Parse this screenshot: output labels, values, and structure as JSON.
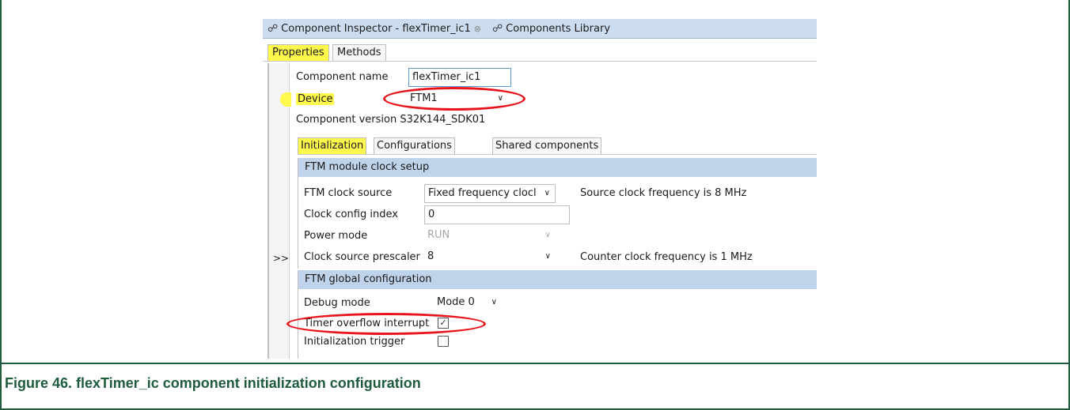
{
  "caption": "Figure 46.  flexTimer_ic component initialization configuration",
  "view_tabs": {
    "inspector": "Component Inspector - flexTimer_ic1",
    "library": "Components Library"
  },
  "prop_tabs": {
    "properties": "Properties",
    "methods": "Methods"
  },
  "component": {
    "name_label": "Component name",
    "name_value": "flexTimer_ic1",
    "device_label": "Device",
    "device_value": "FTM1",
    "version_text": "Component version  S32K144_SDK01"
  },
  "init_tabs": {
    "initialization": "Initialization",
    "configurations": "Configurations",
    "shared": "Shared components"
  },
  "gutter": {
    "expand": ">>"
  },
  "clock_group": {
    "title": "FTM module clock setup",
    "clock_source_label": "FTM clock source",
    "clock_source_value": "Fixed frequency clocl",
    "clock_source_info": "Source clock frequency is 8 MHz",
    "config_index_label": "Clock config index",
    "config_index_value": "0",
    "power_mode_label": "Power mode",
    "power_mode_value": "RUN",
    "prescaler_label": "Clock source prescaler",
    "prescaler_value": "8",
    "prescaler_info": "Counter clock frequency is 1 MHz"
  },
  "global_group": {
    "title": "FTM global configuration",
    "debug_label": "Debug mode",
    "debug_value": "Mode 0",
    "overflow_label": "Timer overflow interrupt",
    "overflow_checked": true,
    "trigger_label": "Initialization trigger",
    "trigger_checked": false
  },
  "colors": {
    "highlight": "#fff94d",
    "annotation": "#e8141b",
    "caption": "#1f5c3e",
    "group_header": "#bfd3ea"
  }
}
